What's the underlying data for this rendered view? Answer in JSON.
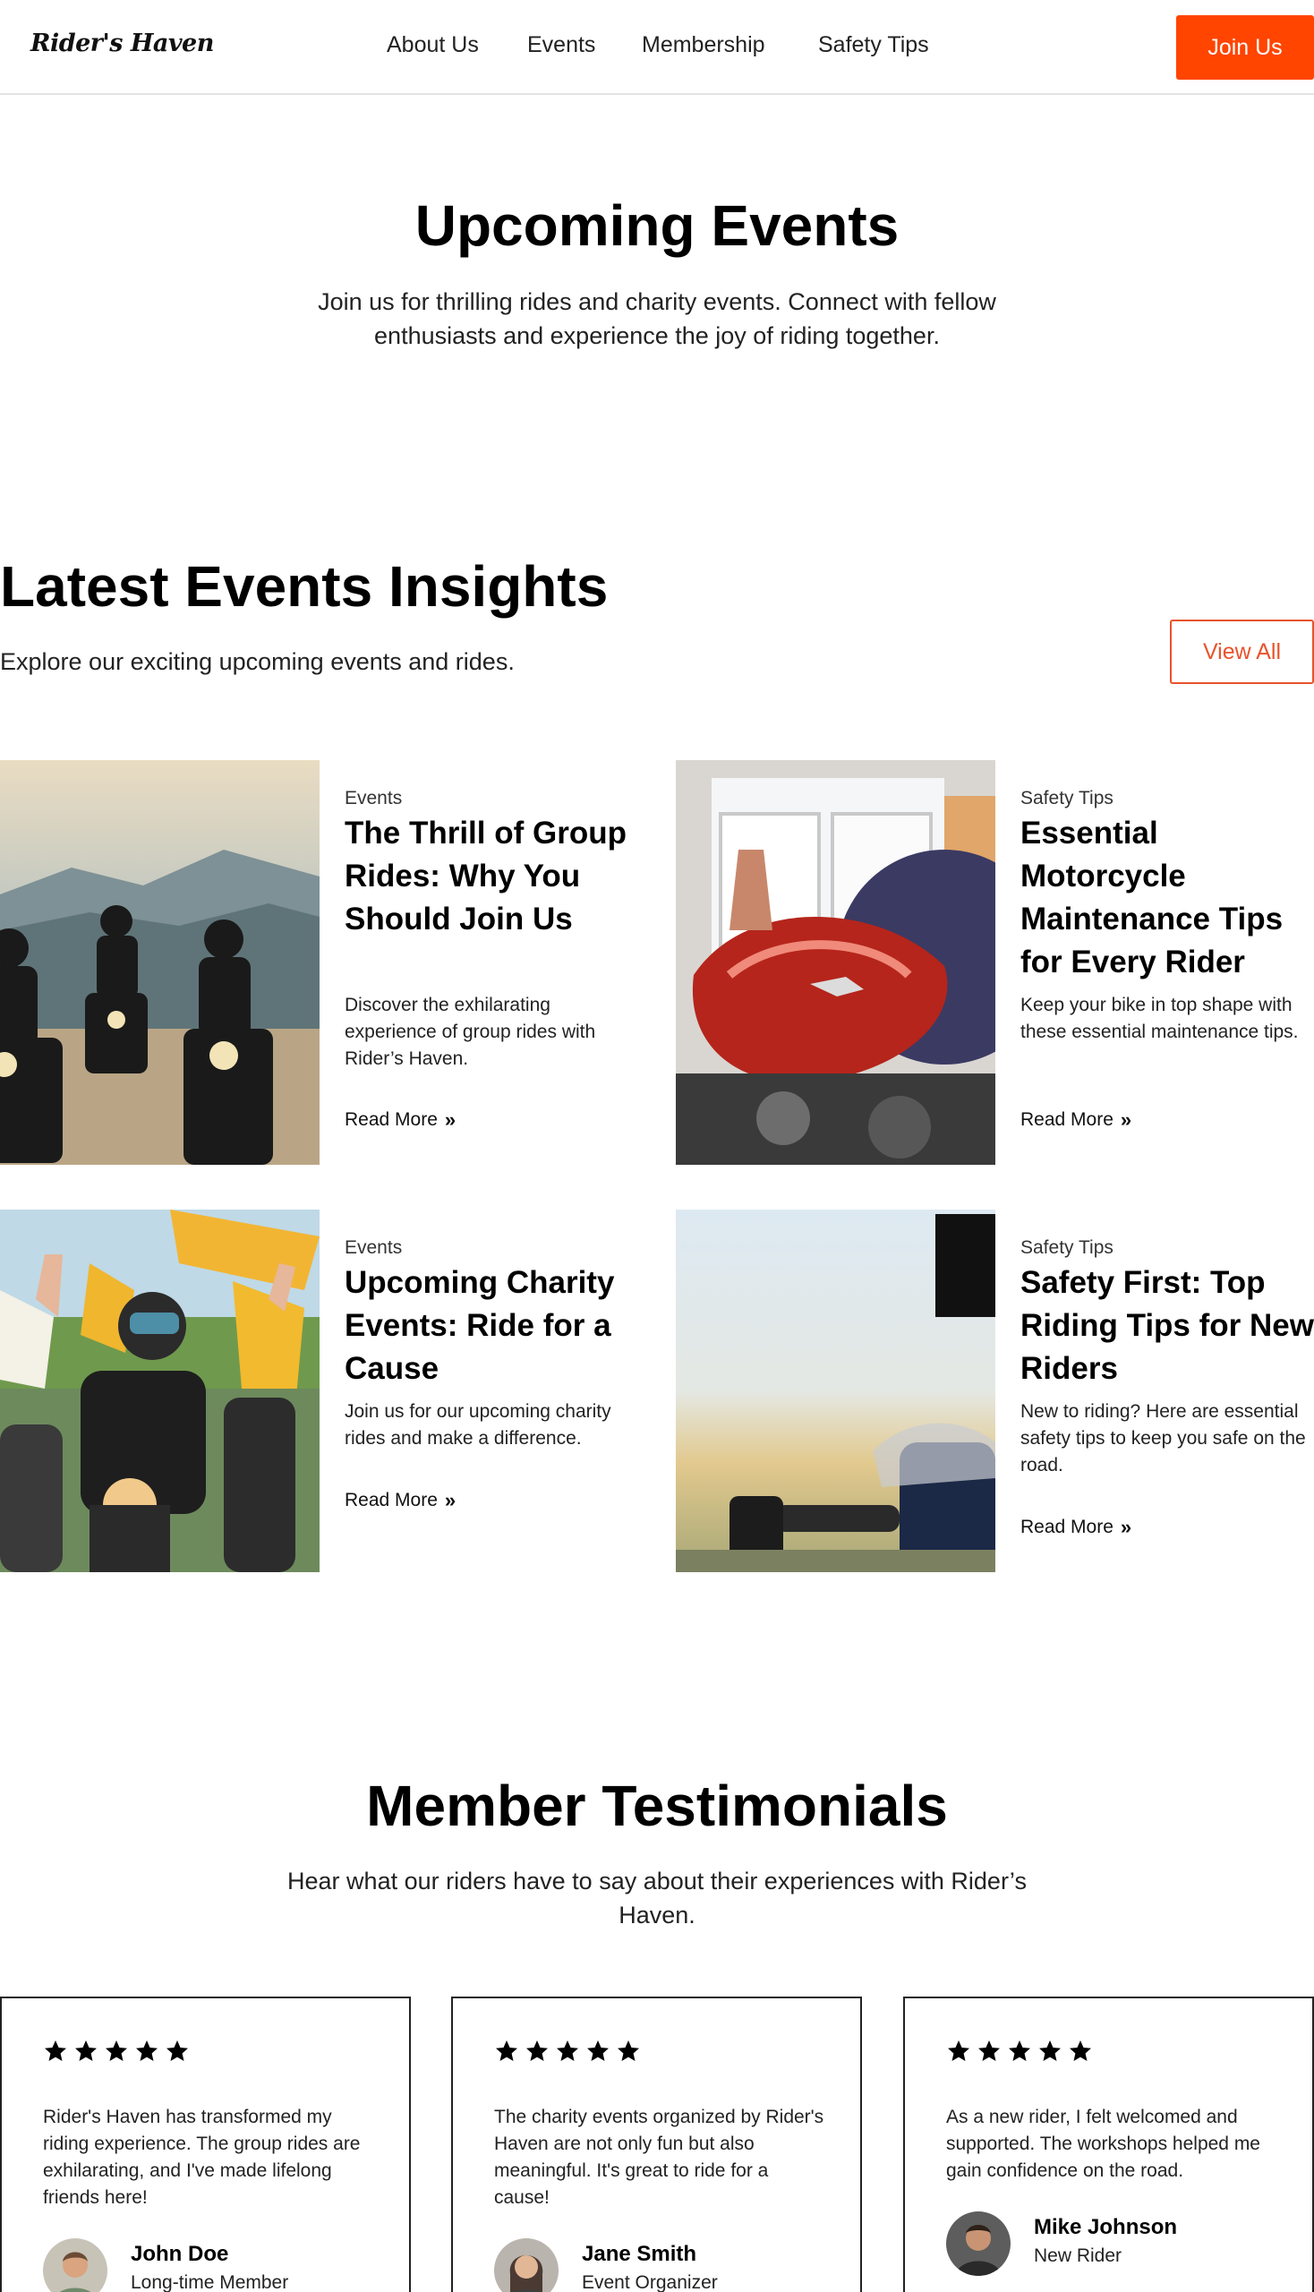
{
  "header": {
    "logo": "Rider's Haven",
    "nav": [
      "About Us",
      "Events",
      "Membership",
      "Safety Tips"
    ],
    "cta": "Join Us"
  },
  "hero": {
    "title": "Upcoming Events",
    "subtitle": "Join us for thrilling rides and charity events. Connect with fellow enthusiasts and experience the joy of riding together."
  },
  "insights": {
    "title": "Latest Events Insights",
    "subtitle": "Explore our exciting upcoming events and rides.",
    "view_all": "View All",
    "read_more": "Read More",
    "cards": [
      {
        "category": "Events",
        "title": "The Thrill of Group Rides: Why You Should Join Us",
        "description": "Discover the exhilarating experience of group rides with Rider’s Haven.",
        "image": "group-ride-photo"
      },
      {
        "category": "Safety Tips",
        "title": "Essential Motorcycle Maintenance Tips for Every Rider",
        "description": "Keep your bike in top shape with these essential maintenance tips.",
        "image": "motorcycle-tank-photo"
      },
      {
        "category": "Events",
        "title": "Upcoming Charity Events: Ride for a Cause",
        "description": "Join us for our upcoming charity rides and make a difference.",
        "image": "charity-ride-photo"
      },
      {
        "category": "Safety Tips",
        "title": "Safety First: Top Riding Tips for New Riders",
        "description": "New to riding? Here are essential safety tips to keep you safe on the road.",
        "image": "motorcycle-field-photo"
      }
    ]
  },
  "testimonials": {
    "title": "Member Testimonials",
    "subtitle": "Hear what our riders have to say about their experiences with Rider’s Haven.",
    "rating": 5,
    "items": [
      {
        "quote": "Rider's Haven has transformed my riding experience. The group rides are exhilarating, and I've made lifelong friends here!",
        "name": "John Doe",
        "role": "Long-time Member"
      },
      {
        "quote": "The charity events organized by Rider's Haven are not only fun but also meaningful. It's great to ride for a cause!",
        "name": "Jane Smith",
        "role": "Event Organizer"
      },
      {
        "quote": "As a new rider, I felt welcomed and supported. The workshops helped me gain confidence on the road.",
        "name": "Mike Johnson",
        "role": "New Rider"
      }
    ]
  },
  "colors": {
    "accent": "#ff4500",
    "outline_accent": "#e8532b",
    "text": "#111111"
  }
}
